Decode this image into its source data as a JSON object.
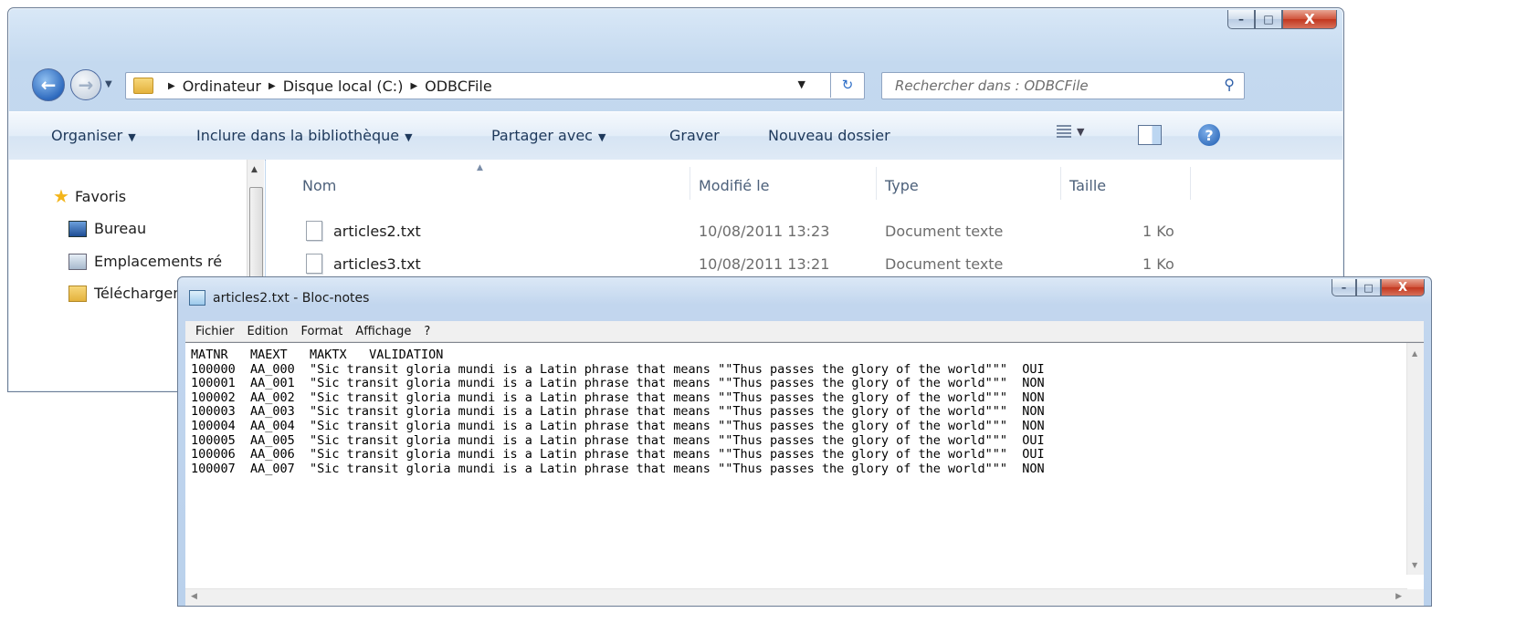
{
  "explorer": {
    "caption": {
      "minimize": "–",
      "maximize": "□",
      "close": "X"
    },
    "breadcrumb": [
      "Ordinateur",
      "Disque local (C:)",
      "ODBCFile"
    ],
    "search": {
      "placeholder": "Rechercher dans : ODBCFile"
    },
    "toolbar": {
      "organize": "Organiser",
      "include": "Inclure dans la bibliothèque",
      "share": "Partager avec",
      "burn": "Graver",
      "new_folder": "Nouveau dossier",
      "help": "?"
    },
    "nav": {
      "favorites": "Favoris",
      "items": [
        "Bureau",
        "Emplacements ré",
        "Téléchargements"
      ]
    },
    "columns": {
      "name": "Nom",
      "modified": "Modifié le",
      "type": "Type",
      "size": "Taille"
    },
    "files": [
      {
        "name": "articles2.txt",
        "modified": "10/08/2011 13:23",
        "type": "Document texte",
        "size": "1 Ko"
      },
      {
        "name": "articles3.txt",
        "modified": "10/08/2011 13:21",
        "type": "Document texte",
        "size": "1 Ko"
      }
    ]
  },
  "notepad": {
    "title": "articles2.txt - Bloc-notes",
    "caption": {
      "minimize": "–",
      "maximize": "□",
      "close": "X"
    },
    "menu": [
      "Fichier",
      "Edition",
      "Format",
      "Affichage",
      "?"
    ],
    "content": "MATNR   MAEXT   MAKTX   VALIDATION\n100000  AA_000  \"Sic transit gloria mundi is a Latin phrase that means \"\"Thus passes the glory of the world\"\"\"  OUI\n100001  AA_001  \"Sic transit gloria mundi is a Latin phrase that means \"\"Thus passes the glory of the world\"\"\"  NON\n100002  AA_002  \"Sic transit gloria mundi is a Latin phrase that means \"\"Thus passes the glory of the world\"\"\"  NON\n100003  AA_003  \"Sic transit gloria mundi is a Latin phrase that means \"\"Thus passes the glory of the world\"\"\"  NON\n100004  AA_004  \"Sic transit gloria mundi is a Latin phrase that means \"\"Thus passes the glory of the world\"\"\"  NON\n100005  AA_005  \"Sic transit gloria mundi is a Latin phrase that means \"\"Thus passes the glory of the world\"\"\"  OUI\n100006  AA_006  \"Sic transit gloria mundi is a Latin phrase that means \"\"Thus passes the glory of the world\"\"\"  OUI\n100007  AA_007  \"Sic transit gloria mundi is a Latin phrase that means \"\"Thus passes the glory of the world\"\"\"  NON"
  }
}
